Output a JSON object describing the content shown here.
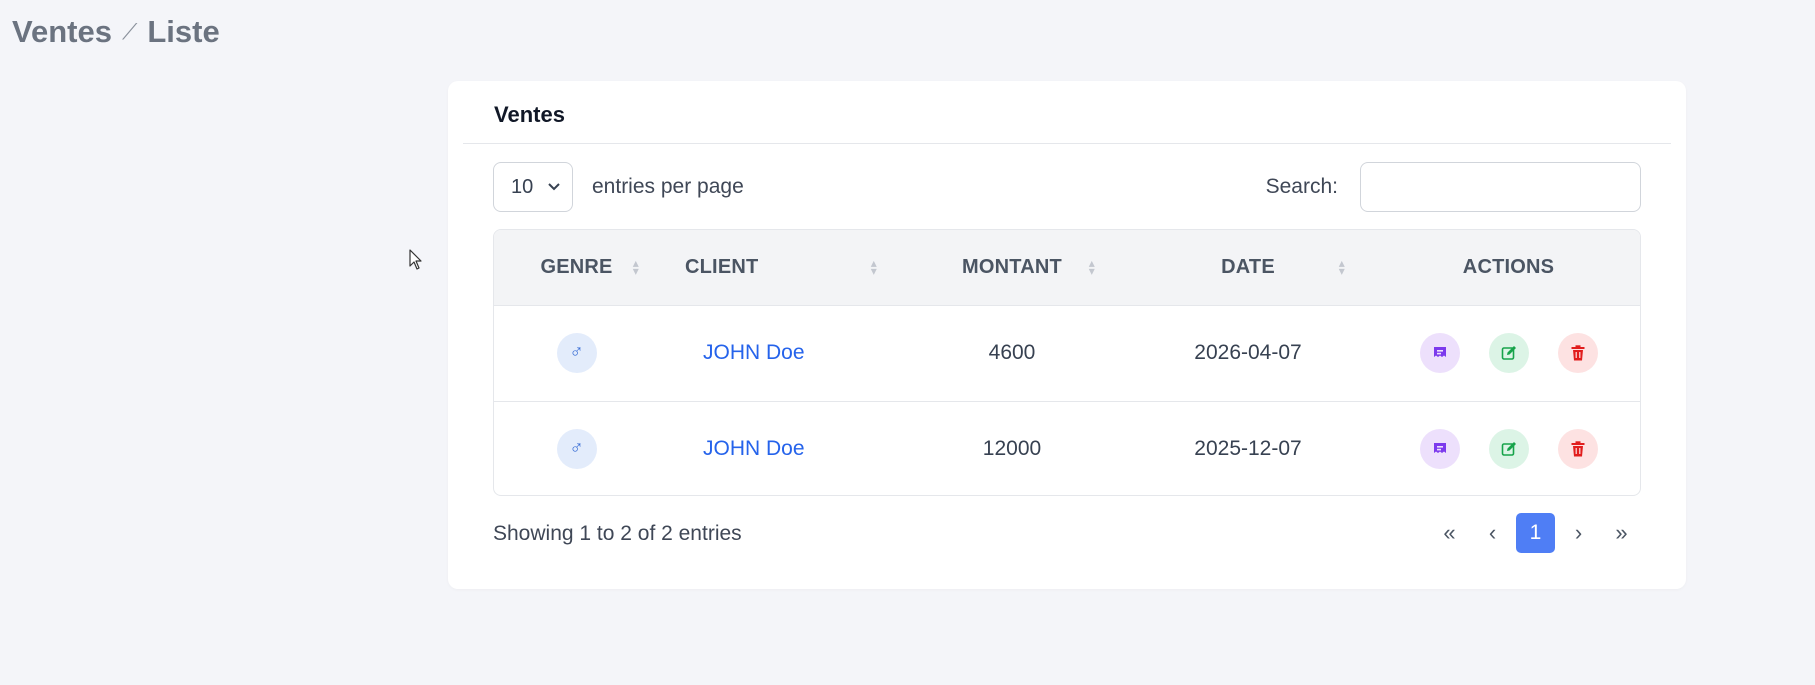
{
  "breadcrumb": {
    "section": "Ventes",
    "separator": "⟋",
    "page": "Liste"
  },
  "card": {
    "title": "Ventes"
  },
  "controls": {
    "per_page_value": "10",
    "per_page_label": "entries per page",
    "search_label": "Search:",
    "search_value": ""
  },
  "table": {
    "headers": {
      "genre": "GENRE",
      "client": "CLIENT",
      "montant": "MONTANT",
      "date": "DATE",
      "actions": "ACTIONS"
    },
    "rows": [
      {
        "genre_icon": "male-icon",
        "genre_symbol": "♂",
        "client": "JOHN Doe",
        "montant": "4600",
        "date": "2026-04-07"
      },
      {
        "genre_icon": "male-icon",
        "genre_symbol": "♂",
        "client": "JOHN Doe",
        "montant": "12000",
        "date": "2025-12-07"
      }
    ]
  },
  "footer": {
    "info": "Showing 1 to 2 of 2 entries"
  },
  "pagination": {
    "first": "«",
    "prev": "‹",
    "current": "1",
    "next": "›",
    "last": "»"
  },
  "colors": {
    "background": "#f4f5f9",
    "link": "#2563eb",
    "active_page": "#4f7ef5",
    "receipt": "#7c3aed",
    "edit": "#16a34a",
    "delete": "#e11d1d"
  }
}
